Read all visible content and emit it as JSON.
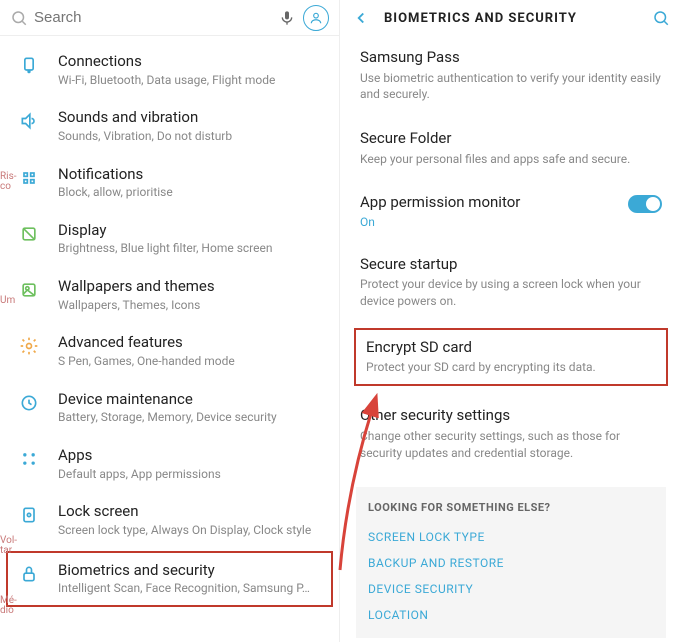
{
  "search": {
    "placeholder": "Search"
  },
  "settings": [
    {
      "key": "connections",
      "title": "Connections",
      "sub": "Wi-Fi, Bluetooth, Data usage, Flight mode",
      "iconColor": "#3ba9d6"
    },
    {
      "key": "sounds",
      "title": "Sounds and vibration",
      "sub": "Sounds, Vibration, Do not disturb",
      "iconColor": "#3ba9d6"
    },
    {
      "key": "notifications",
      "title": "Notifications",
      "sub": "Block, allow, prioritise",
      "iconColor": "#3ba9d6"
    },
    {
      "key": "display",
      "title": "Display",
      "sub": "Brightness, Blue light filter, Home screen",
      "iconColor": "#6ec05f"
    },
    {
      "key": "wallpapers",
      "title": "Wallpapers and themes",
      "sub": "Wallpapers, Themes, Icons",
      "iconColor": "#6ec05f"
    },
    {
      "key": "advanced",
      "title": "Advanced features",
      "sub": "S Pen, Games, One-handed mode",
      "iconColor": "#f0a94a"
    },
    {
      "key": "maintenance",
      "title": "Device maintenance",
      "sub": "Battery, Storage, Memory, Device security",
      "iconColor": "#3ba9d6"
    },
    {
      "key": "apps",
      "title": "Apps",
      "sub": "Default apps, App permissions",
      "iconColor": "#3ba9d6"
    },
    {
      "key": "lockscreen",
      "title": "Lock screen",
      "sub": "Screen lock type, Always On Display, Clock style",
      "iconColor": "#3ba9d6"
    },
    {
      "key": "biometrics",
      "title": "Biometrics and security",
      "sub": "Intelligent Scan, Face Recognition, Samsung P…",
      "iconColor": "#3ba9d6"
    }
  ],
  "annotations": {
    "risco": "Ris-co",
    "um": "Um",
    "voltar": "Vol-tar",
    "medio": "Mé-dio"
  },
  "rightHeader": "BIOMETRICS AND SECURITY",
  "sections": [
    {
      "key": "samsungpass",
      "title": "Samsung Pass",
      "sub": "Use biometric authentication to verify your identity easily and securely."
    },
    {
      "key": "securefolder",
      "title": "Secure Folder",
      "sub": "Keep your personal files and apps safe and secure."
    },
    {
      "key": "appperm",
      "title": "App permission monitor",
      "sub": "On",
      "toggle": true
    },
    {
      "key": "securestartup",
      "title": "Secure startup",
      "sub": "Protect your device by using a screen lock when your device powers on."
    },
    {
      "key": "encrypt",
      "title": "Encrypt SD card",
      "sub": "Protect your SD card by encrypting its data."
    },
    {
      "key": "othersec",
      "title": "Other security settings",
      "sub": "Change other security settings, such as those for security updates and credential storage."
    }
  ],
  "looking": {
    "title": "LOOKING FOR SOMETHING ELSE?",
    "links": [
      "SCREEN LOCK TYPE",
      "BACKUP AND RESTORE",
      "DEVICE SECURITY",
      "LOCATION"
    ]
  }
}
